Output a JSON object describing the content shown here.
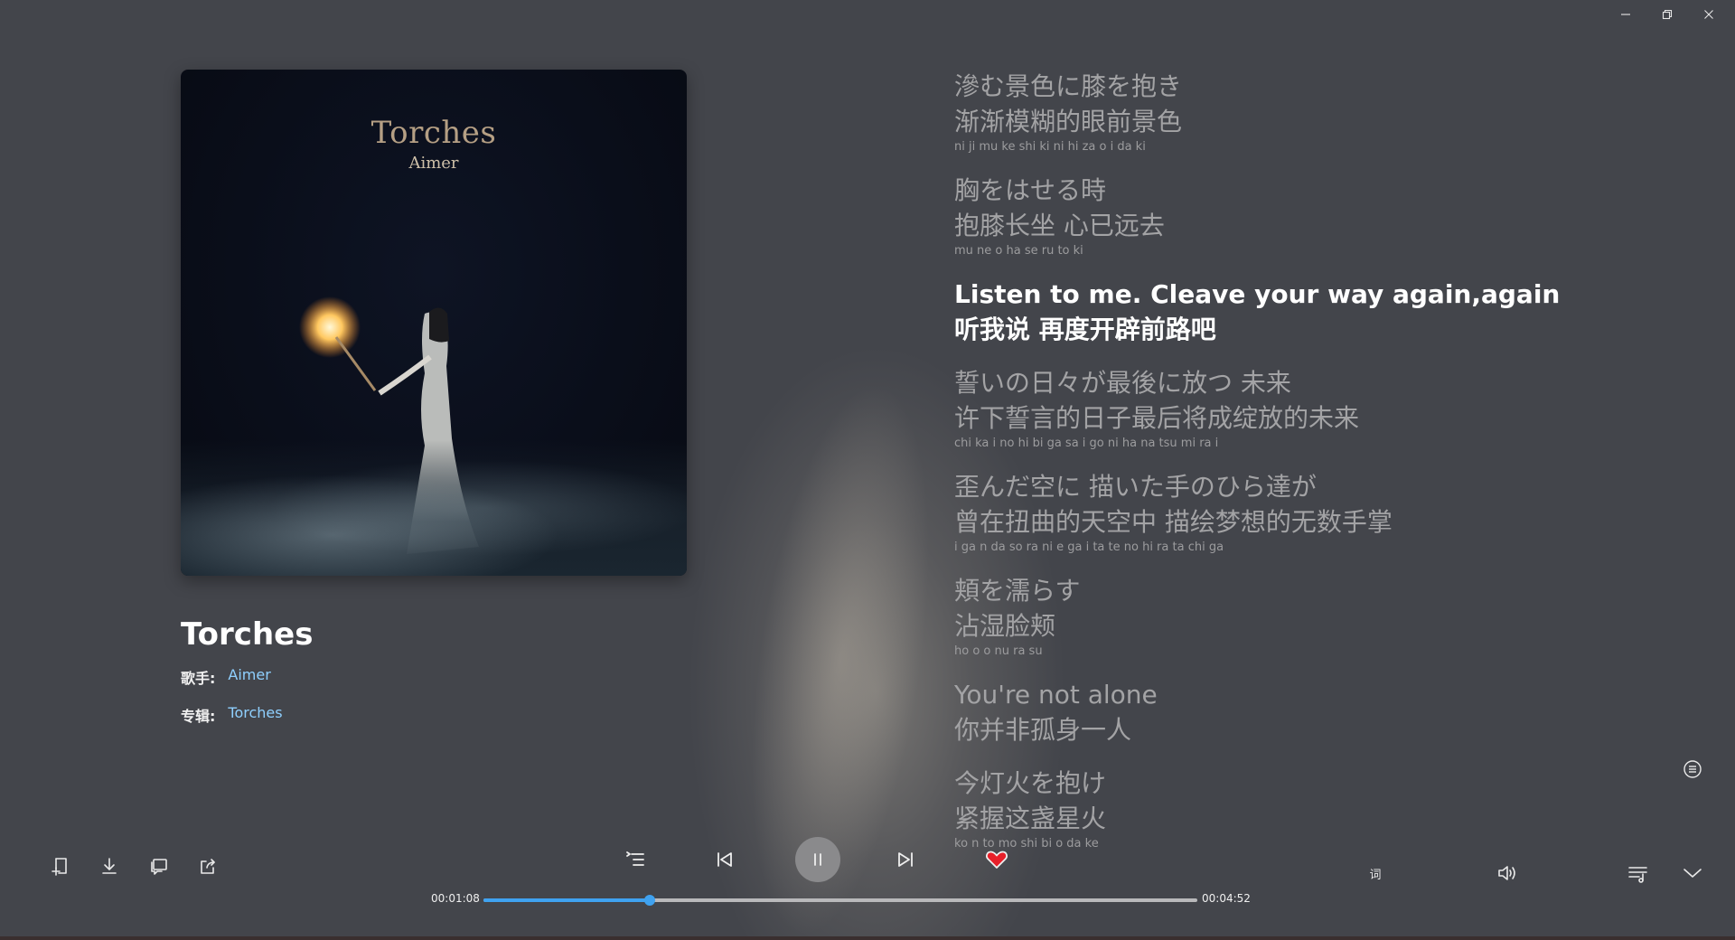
{
  "window": {
    "minimize_icon": "minimize-icon",
    "restore_icon": "restore-icon",
    "close_icon": "close-icon"
  },
  "cover": {
    "title": "Torches",
    "artist": "Aimer"
  },
  "song": {
    "title": "Torches",
    "artist_label": "歌手:",
    "artist": "Aimer",
    "album_label": "专辑:",
    "album": "Torches"
  },
  "lyrics": [
    {
      "orig": "滲む景色に膝を抱き",
      "trans": "渐渐模糊的眼前景色",
      "roma": "ni ji mu ke shi ki ni hi za o i da ki",
      "active": false
    },
    {
      "orig": "胸をはせる時",
      "trans": "抱膝长坐 心已远去",
      "roma": "mu ne o ha se ru to ki",
      "active": false
    },
    {
      "orig": "Listen to me. Cleave your way again,again",
      "trans": "听我说 再度开辟前路吧",
      "roma": "",
      "active": true
    },
    {
      "orig": "誓いの日々が最後に放つ 未来",
      "trans": "许下誓言的日子最后将成绽放的未来",
      "roma": "chi ka i no hi bi ga sa i go ni ha na tsu mi ra i",
      "active": false
    },
    {
      "orig": "歪んだ空に 描いた手のひら達が",
      "trans": "曾在扭曲的天空中 描绘梦想的无数手掌",
      "roma": "i ga n da so ra ni e ga i ta te no hi ra ta chi ga",
      "active": false
    },
    {
      "orig": "頬を濡らす",
      "trans": "沾湿脸颊",
      "roma": "ho o o nu ra su",
      "active": false
    },
    {
      "orig": "You're not alone",
      "trans": "你并非孤身一人",
      "roma": "",
      "active": false
    },
    {
      "orig": "今灯火を抱け",
      "trans": "紧握这盏星火",
      "roma": "ko n to mo shi bi o da ke",
      "active": false
    }
  ],
  "player": {
    "current_time": "00:01:08",
    "total_time": "00:04:52",
    "progress": 0.2329,
    "liked": true,
    "like_color": "#e8202a",
    "accent_color": "#3fa2f0",
    "lyric_toggle_label": "词"
  },
  "icons": {
    "tools": [
      "add-to-playlist-icon",
      "download-icon",
      "comment-icon",
      "share-icon"
    ],
    "controls": [
      "playlist-icon",
      "previous-icon",
      "pause-icon",
      "next-icon",
      "heart-icon"
    ],
    "right": [
      "volume-icon",
      "queue-icon",
      "collapse-icon",
      "lyric-menu-icon"
    ]
  }
}
